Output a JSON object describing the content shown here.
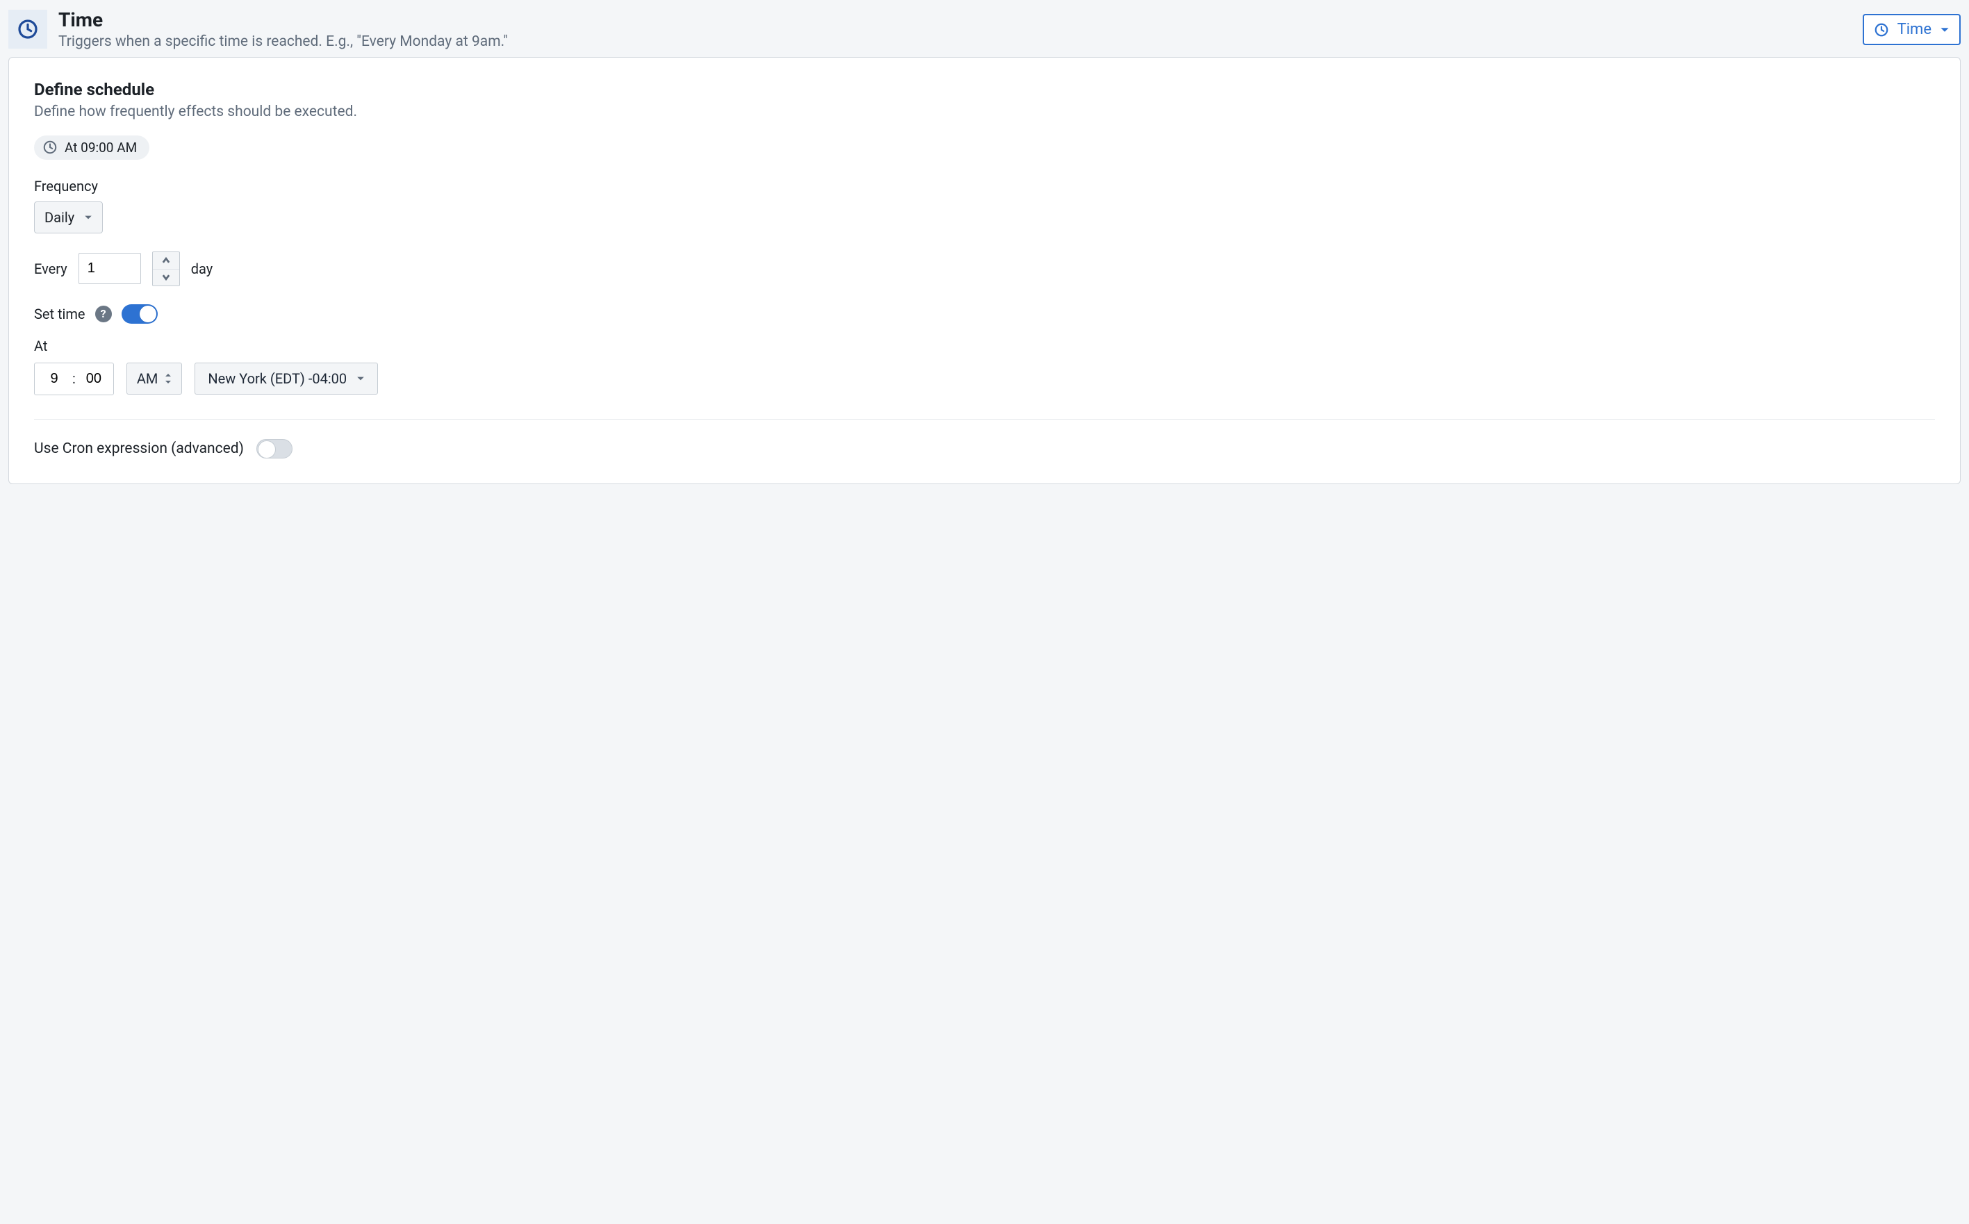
{
  "header": {
    "title": "Time",
    "subtitle": "Triggers when a specific time is reached. E.g., \"Every Monday at 9am.\"",
    "type_selector_label": "Time"
  },
  "schedule": {
    "title": "Define schedule",
    "subtitle": "Define how frequently effects should be executed.",
    "summary_chip": "At 09:00 AM",
    "frequency": {
      "label": "Frequency",
      "value": "Daily"
    },
    "every": {
      "prefix": "Every",
      "value": "1",
      "unit": "day"
    },
    "set_time": {
      "label": "Set time",
      "enabled": true
    },
    "at": {
      "label": "At",
      "hour": "9",
      "minute": "00",
      "meridiem": "AM",
      "timezone": "New York (EDT) -04:00"
    },
    "cron": {
      "label": "Use Cron expression (advanced)",
      "enabled": false
    }
  }
}
